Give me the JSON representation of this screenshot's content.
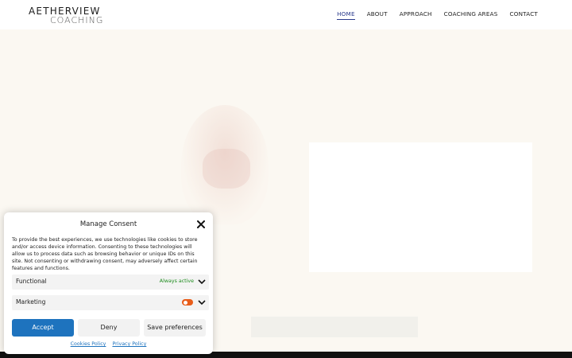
{
  "brand": {
    "line1": "AETHERVIEW",
    "line2": "COACHING"
  },
  "nav": {
    "items": [
      {
        "label": "HOME",
        "active": true
      },
      {
        "label": "ABOUT",
        "active": false
      },
      {
        "label": "APPROACH",
        "active": false
      },
      {
        "label": "COACHING AREAS",
        "active": false
      },
      {
        "label": "CONTACT",
        "active": false
      }
    ]
  },
  "consent": {
    "title": "Manage Consent",
    "description": "To provide the best experiences, we use technologies like cookies to store and/or access device information. Consenting to these technologies will allow us to process data such as browsing behavior or unique IDs on this site. Not consenting or withdrawing consent, may adversely affect certain features and functions.",
    "categories": [
      {
        "label": "Functional",
        "status": "Always active"
      },
      {
        "label": "Marketing",
        "toggle_on": true
      }
    ],
    "buttons": {
      "accept": "Accept",
      "deny": "Deny",
      "save": "Save preferences"
    },
    "links": {
      "cookies": "Cookies Policy",
      "privacy": "Privacy Policy"
    }
  },
  "colors": {
    "accent": "#1e73be",
    "nav_active": "#2a3a8c",
    "toggle": "#e85d1a",
    "always_active": "#1e8c1e"
  }
}
